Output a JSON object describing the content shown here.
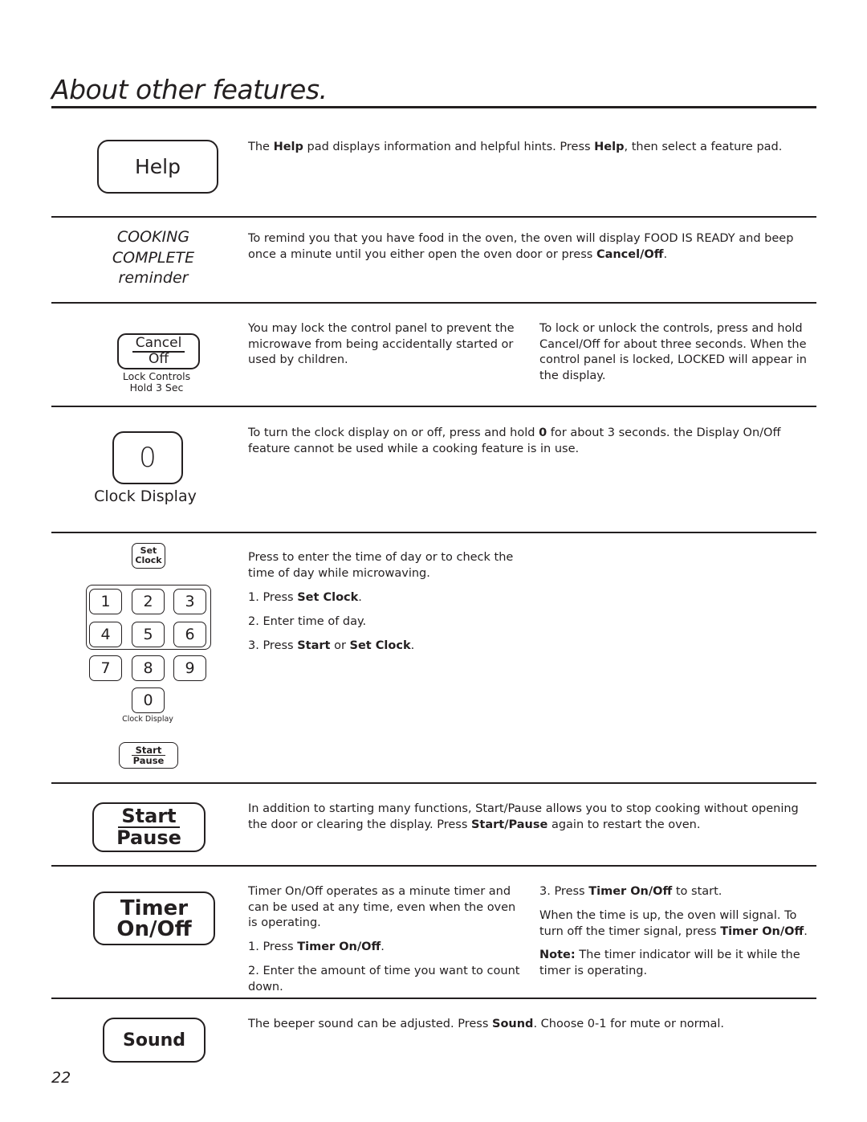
{
  "page": {
    "title": "About other features.",
    "page_number": "22"
  },
  "sections": {
    "help": {
      "pad_label": "Help",
      "text_pre": "The ",
      "text_b1": "Help",
      "text_mid": " pad displays information and helpful hints. Press ",
      "text_b2": "Help",
      "text_post": ", then select a feature pad."
    },
    "cooking_complete": {
      "label_line1": "COOKING",
      "label_line2": "COMPLETE",
      "label_line3": "reminder",
      "text_pre": "To remind you that you have food in the oven, the oven will display FOOD IS READY  and beep once a minute until you either open the oven door or press ",
      "text_b1": "Cancel/Off",
      "text_post": "."
    },
    "lock": {
      "pad_line1": "Cancel",
      "pad_line2": "Off",
      "caption_line1": "Lock Controls",
      "caption_line2": "Hold 3 Sec",
      "text_left": "You may lock the control panel to prevent the microwave from being accidentally started or used by children.",
      "text_right": "To lock or unlock the controls, press and hold Cancel/Off for about three seconds. When the control panel is locked, LOCKED will appear in the display."
    },
    "clock_display": {
      "pad_label": "0",
      "caption": "Clock Display",
      "text_pre": "To turn the clock display on or off, press and hold ",
      "text_b1": "0",
      "text_post": " for about 3 seconds. the Display On/Off feature cannot be used while a cooking feature is in use."
    },
    "set_clock": {
      "pad_line1": "Set",
      "pad_line2": "Clock",
      "keys": [
        "1",
        "2",
        "3",
        "4",
        "5",
        "6",
        "7",
        "8",
        "9",
        "0"
      ],
      "zero_caption": "Clock Display",
      "start_line1": "Start",
      "start_line2": "Pause",
      "intro": "Press to enter the time of day or to check the time of day while microwaving.",
      "step1_pre": "1. Press ",
      "step1_b": "Set Clock",
      "step1_post": ".",
      "step2": "2. Enter time of day.",
      "step3_pre": "3. Press ",
      "step3_b1": "Start",
      "step3_mid": " or ",
      "step3_b2": "Set Clock",
      "step3_post": "."
    },
    "start_pause": {
      "pad_line1": "Start",
      "pad_line2": "Pause",
      "text_pre": "In addition to starting many functions, Start/Pause allows you to stop cooking without opening the door or clearing the display. Press ",
      "text_b1": "Start/Pause",
      "text_post": " again to restart the oven."
    },
    "timer": {
      "pad_line1": "Timer",
      "pad_line2": "On/Off",
      "intro": "Timer On/Off operates as a minute timer and can be used at any time, even when the oven is operating.",
      "step1_pre": "1. Press ",
      "step1_b": "Timer On/Off",
      "step1_post": ".",
      "step2": "2. Enter the amount of time you want to count down.",
      "step3_pre": "3. Press ",
      "step3_b": "Timer On/Off",
      "step3_post": " to start.",
      "signal_pre": "When the time is up, the oven will signal. To turn off the timer signal, press ",
      "signal_b": "Timer On/Off",
      "signal_post": ".",
      "note_b": "Note:",
      "note_text": " The timer indicator will be it while the timer is operating."
    },
    "sound": {
      "pad_label": "Sound",
      "text_pre": "The beeper sound can be adjusted. Press ",
      "text_b1": "Sound",
      "text_post": ". Choose 0-1 for mute or normal."
    }
  }
}
